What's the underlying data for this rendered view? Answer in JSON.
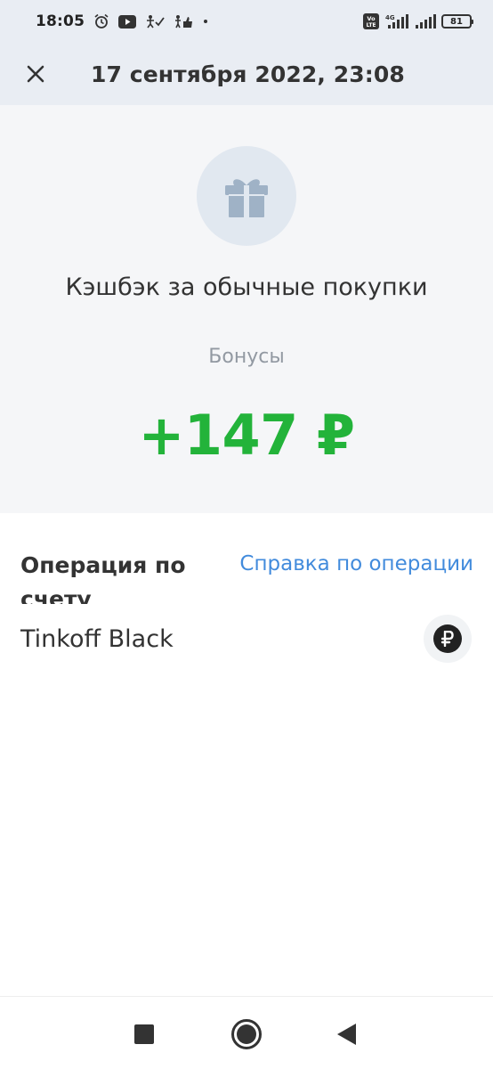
{
  "status_bar": {
    "time": "18:05",
    "network": "4G",
    "volte": "Vo LTE",
    "battery": "81",
    "icons": [
      "alarm-icon",
      "youtube-icon",
      "app-icon",
      "thumb-icon",
      "dot-icon"
    ]
  },
  "header": {
    "title": "17 сентября 2022, 23:08",
    "close_icon": "close-icon"
  },
  "summary": {
    "icon": "gift-icon",
    "title": "Кэшбэк за обычные покупки",
    "subtitle": "Бонусы",
    "amount": "+147 ₽",
    "amount_color": "#23b33a"
  },
  "operation": {
    "title": "Операция по счету",
    "help_link": "Справка по операции",
    "account_name": "Tinkoff Black",
    "account_icon": "ruble-icon"
  },
  "nav_bar": {
    "buttons": [
      "recent-apps-icon",
      "home-icon",
      "back-icon"
    ]
  },
  "colors": {
    "accent": "#428bdc",
    "success": "#23b33a",
    "header_bg": "#e9edf3",
    "summary_bg": "#f5f6f8"
  }
}
